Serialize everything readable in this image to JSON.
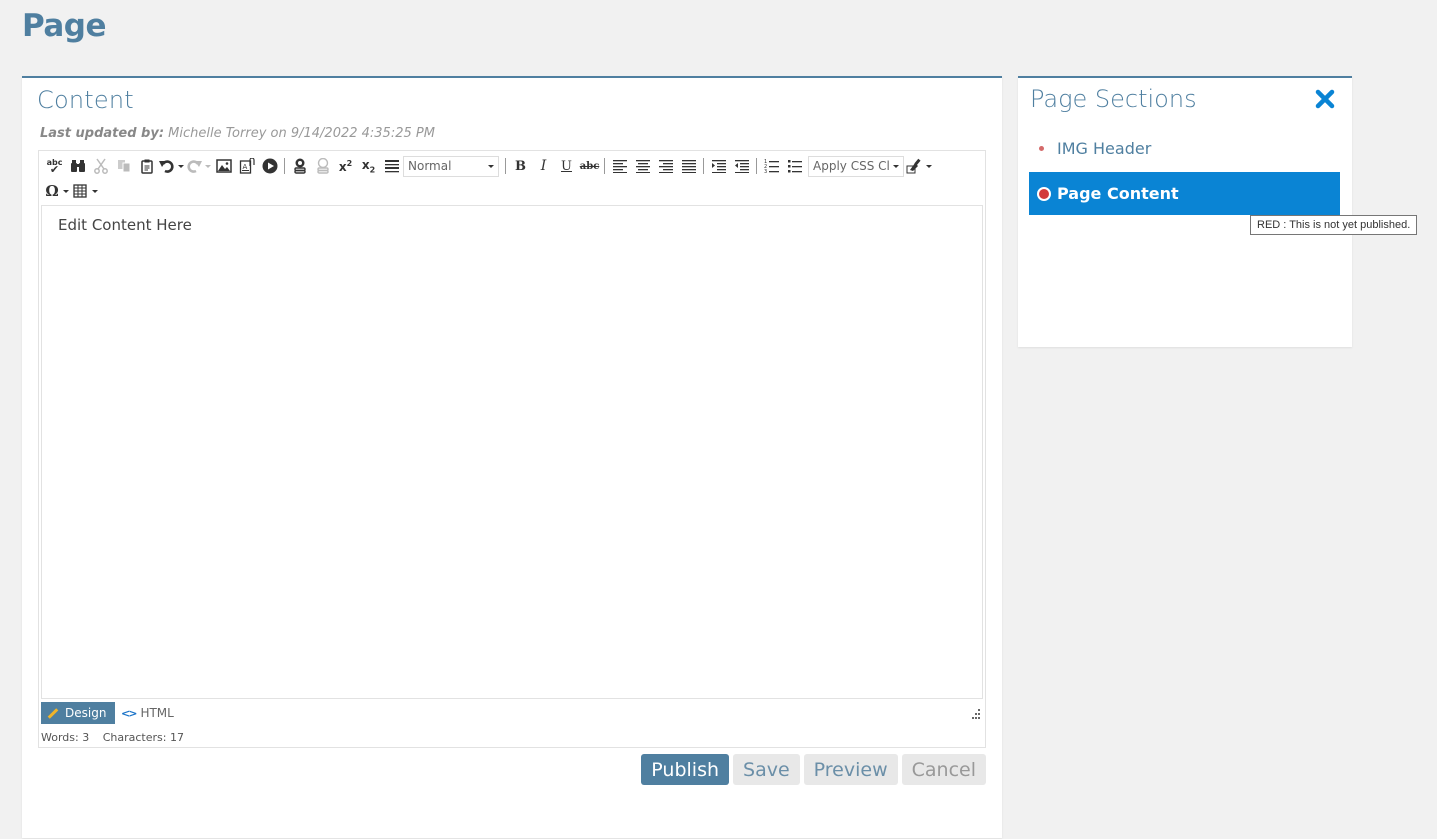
{
  "page": {
    "title": "Page"
  },
  "content": {
    "title": "Content",
    "last_updated_label": "Last updated by:",
    "last_updated_value": "Michelle Torrey on 9/14/2022 4:35:25 PM",
    "editor": {
      "body_text": "Edit Content Here",
      "format_select": "Normal",
      "css_class_select": "Apply CSS Cl...",
      "toolbar_row1": [
        "spellcheck",
        "find",
        "cut",
        "copy",
        "paste",
        "undo",
        "redo",
        "insert-image",
        "document-manager",
        "media",
        "hyperlink",
        "remove-link",
        "superscript",
        "subscript",
        "paragraph",
        "format",
        "bold",
        "italic",
        "underline",
        "strikethrough",
        "align-left",
        "align-center",
        "align-right",
        "justify",
        "indent",
        "outdent",
        "numbered-list",
        "bulleted-list",
        "css-class",
        "format-stripper"
      ],
      "toolbar_row2": [
        "special-characters",
        "insert-table"
      ],
      "glyphs": {
        "bold": "B",
        "italic": "I",
        "underline": "U",
        "strike": "abc",
        "omega": "Ω"
      },
      "modes": {
        "design": "Design",
        "html": "HTML"
      },
      "stats": {
        "words": "Words: 3",
        "characters": "Characters: 17"
      }
    },
    "buttons": {
      "publish": "Publish",
      "save": "Save",
      "preview": "Preview",
      "cancel": "Cancel"
    }
  },
  "sections": {
    "title": "Page Sections",
    "items": [
      {
        "label": "IMG Header",
        "status": "red",
        "selected": false
      },
      {
        "label": "Page Content",
        "status": "red",
        "selected": true
      }
    ],
    "tooltip": "RED : This is not yet published."
  },
  "colors": {
    "brand": "#4f7fa0",
    "selected": "#0a84d4",
    "unpublished": "#d23b3b"
  }
}
